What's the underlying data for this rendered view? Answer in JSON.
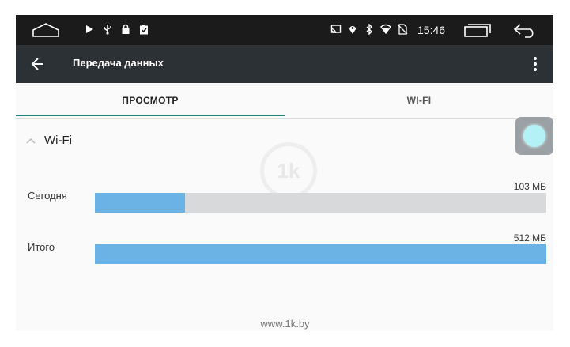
{
  "status_bar": {
    "time": "15:46",
    "left_icons": [
      "play-icon",
      "usb-icon",
      "lock-icon",
      "clipboard-check-icon"
    ],
    "right_icons": [
      "cast-icon",
      "location-icon",
      "bluetooth-icon",
      "wifi-icon",
      "no-sim-icon"
    ]
  },
  "toolbar": {
    "title": "Передача данных"
  },
  "tabs": [
    {
      "label": "ПРОСМОТР",
      "active": true
    },
    {
      "label": "WI-FI",
      "active": false
    }
  ],
  "section": {
    "title": "Wi-Fi"
  },
  "usage_rows": [
    {
      "label": "Сегодня",
      "value": "103 МБ",
      "fill_fraction": 0.2
    },
    {
      "label": "Итого",
      "value": "512 МБ",
      "fill_fraction": 1.0
    }
  ],
  "watermark": {
    "logo_text": "1k",
    "footer": "www.1k.by"
  },
  "colors": {
    "accent": "#1d8a7e",
    "bar_fill": "#6bb3e4",
    "bar_track": "#d7d9da",
    "toolbar": "#2c3135",
    "statusbar": "#1b1b1b"
  }
}
